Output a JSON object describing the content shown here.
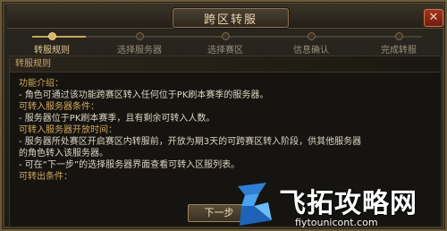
{
  "window": {
    "title": "跨区转服",
    "close_label": "✕"
  },
  "steps": [
    {
      "label": "转服规则",
      "active": true
    },
    {
      "label": "选择服务器",
      "active": false
    },
    {
      "label": "选择赛区",
      "active": false
    },
    {
      "label": "信息确认",
      "active": false
    },
    {
      "label": "完成转服",
      "active": false
    }
  ],
  "content": {
    "section_title": "转服规则",
    "lines": [
      {
        "text": "功能介绍：",
        "kind": "head"
      },
      {
        "text": "- 角色可通过该功能跨赛区转入任何位于PK刷本赛季的服务器。",
        "kind": "body"
      },
      {
        "text": "可转入服务器条件：",
        "kind": "head"
      },
      {
        "text": "- 服务器位于PK刷本赛季，且有剩余可转入人数。",
        "kind": "body"
      },
      {
        "text": "可转入服务器开放时间：",
        "kind": "head"
      },
      {
        "text": "- 服务器所处赛区开启赛区内转服前，开放为期3天的可跨赛区转入阶段，供其他服务器",
        "kind": "body"
      },
      {
        "text": "的角色转入该服务器。",
        "kind": "body"
      },
      {
        "text": "- 可在“下一步”的选择服务器界面查看可转入区服列表。",
        "kind": "body"
      },
      {
        "text": "可转出条件：",
        "kind": "head"
      }
    ]
  },
  "footer": {
    "next_label": "下一步"
  },
  "watermark": {
    "title": "飞拓攻略网",
    "url": "fiytounicont.com"
  },
  "colors": {
    "accent": "#c9a45a",
    "heading": "#d2a85a",
    "body_text": "#ddd6c6"
  }
}
